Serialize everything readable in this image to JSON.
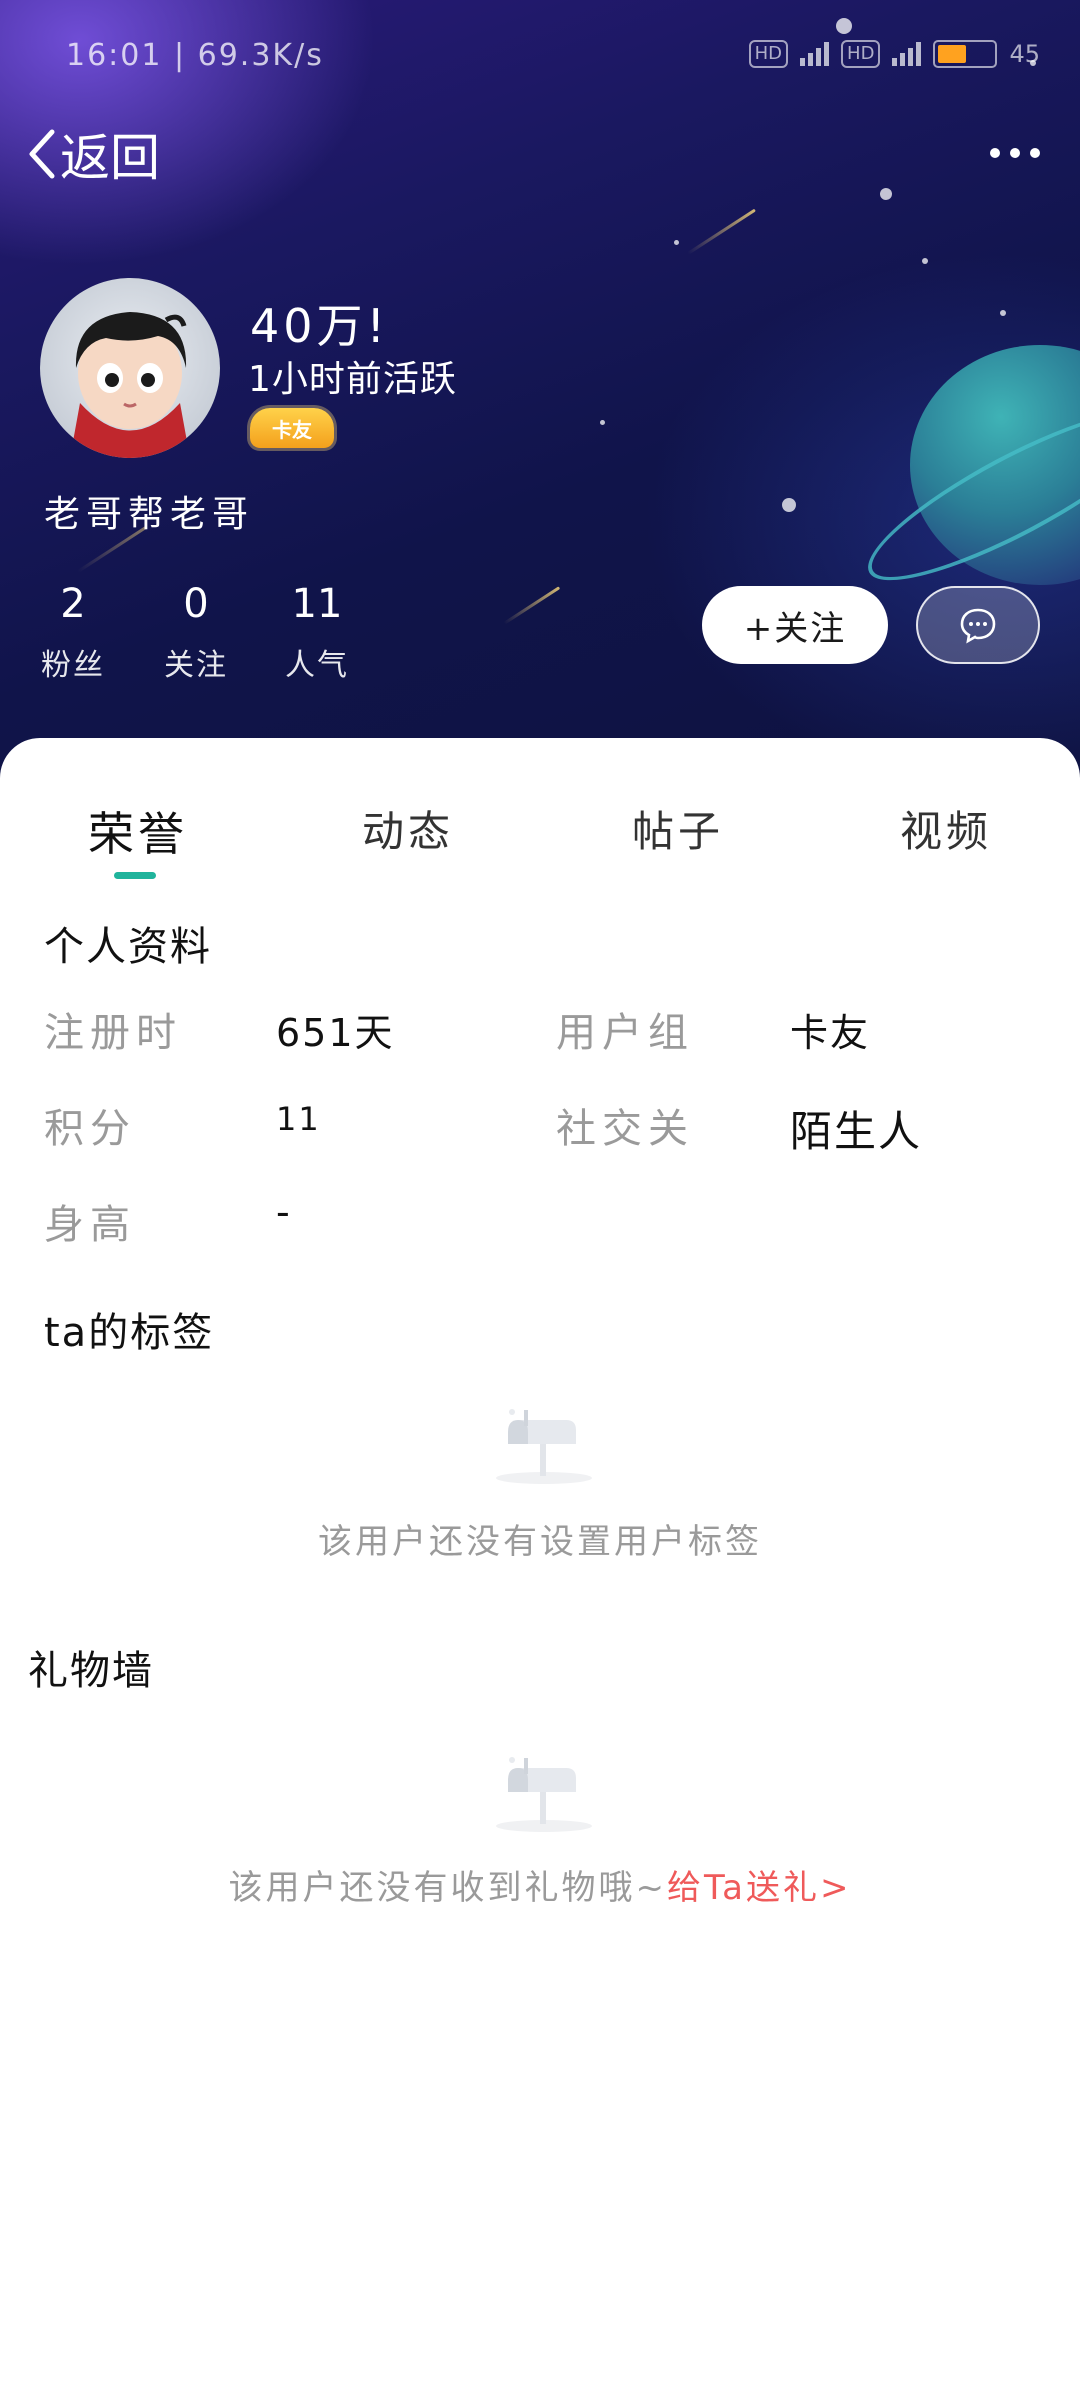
{
  "status_bar": {
    "time_speed": "16:01 | 69.3K/s",
    "hd1": "HD",
    "hd2": "HD",
    "battery_percent": "45"
  },
  "nav": {
    "back_label": "返回"
  },
  "profile": {
    "username": "40万!",
    "last_active": "1小时前活跃",
    "badge_label": "卡友",
    "signature": "老哥帮老哥",
    "stats": [
      {
        "value": "2",
        "label": "粉丝"
      },
      {
        "value": "0",
        "label": "关注"
      },
      {
        "value": "11",
        "label": "人气"
      }
    ],
    "follow_label": "+关注"
  },
  "tabs": [
    {
      "label": "荣誉",
      "active": true
    },
    {
      "label": "动态",
      "active": false
    },
    {
      "label": "帖子",
      "active": false
    },
    {
      "label": "视频",
      "active": false
    }
  ],
  "personal_info": {
    "title": "个人资料",
    "rows": [
      {
        "label": "注册时",
        "value": "651天"
      },
      {
        "label": "用户组",
        "value": "卡友"
      },
      {
        "label": "积分",
        "value": "11"
      },
      {
        "label": "社交关",
        "value": "陌生人"
      },
      {
        "label": "身高",
        "value": "-"
      }
    ]
  },
  "tags_section": {
    "title": "ta的标签",
    "empty_text": "该用户还没有设置用户标签"
  },
  "gift_wall": {
    "title": "礼物墙",
    "empty_text": "该用户还没有收到礼物哦~",
    "gift_link": "给Ta送礼>"
  },
  "colors": {
    "accent": "#20b49c",
    "gift_link": "#ef5a5a",
    "hero_bg": "#10144a"
  },
  "icons": [
    "back-chevron-icon",
    "more-icon",
    "chat-bubble-icon",
    "mailbox-icon"
  ]
}
